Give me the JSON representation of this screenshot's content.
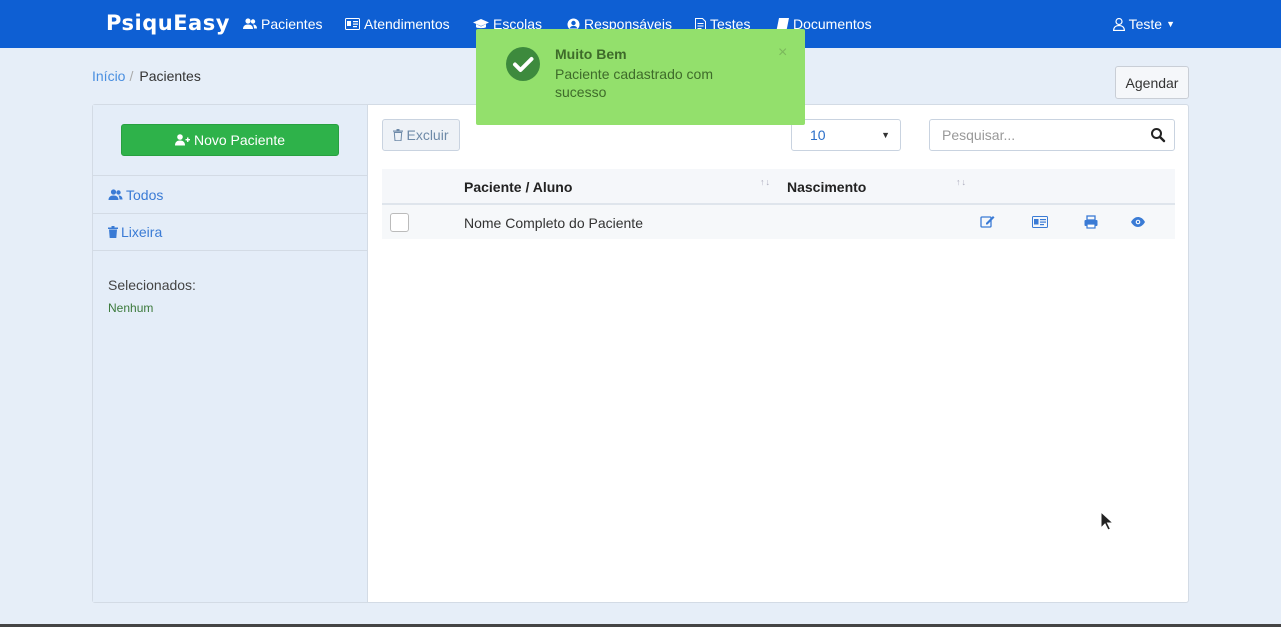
{
  "navbar": {
    "brand": "PsiquEasy",
    "items": [
      {
        "label": "Pacientes",
        "icon": "users-icon"
      },
      {
        "label": "Atendimentos",
        "icon": "id-card-icon"
      },
      {
        "label": "Escolas",
        "icon": "graduation-cap-icon"
      },
      {
        "label": "Responsáveis",
        "icon": "user-circle-icon"
      },
      {
        "label": "Testes",
        "icon": "file-icon"
      },
      {
        "label": "Documentos",
        "icon": "book-icon"
      }
    ],
    "user": "Teste"
  },
  "breadcrumb": {
    "home": "Início",
    "separator": "/",
    "current": "Pacientes"
  },
  "header": {
    "agendar_label": "Agendar"
  },
  "sidebar": {
    "new_button": "Novo Paciente",
    "items": [
      {
        "label": "Todos",
        "icon": "users-icon"
      },
      {
        "label": "Lixeira",
        "icon": "trash-icon"
      }
    ],
    "selected_label": "Selecionados:",
    "selected_value": "Nenhum"
  },
  "toolbar": {
    "delete_label": "Excluir",
    "page_size": "10",
    "search_placeholder": "Pesquisar..."
  },
  "table": {
    "columns": [
      "Paciente / Aluno",
      "Nascimento"
    ],
    "rows": [
      {
        "name": "Nome Completo do Paciente",
        "birth": ""
      }
    ]
  },
  "toast": {
    "title": "Muito Bem",
    "message": "Paciente cadastrado com sucesso",
    "close": "×"
  },
  "colors": {
    "navbar": "#0e5fd3",
    "primary_button": "#2eb24a",
    "toast": "#93e06c"
  }
}
